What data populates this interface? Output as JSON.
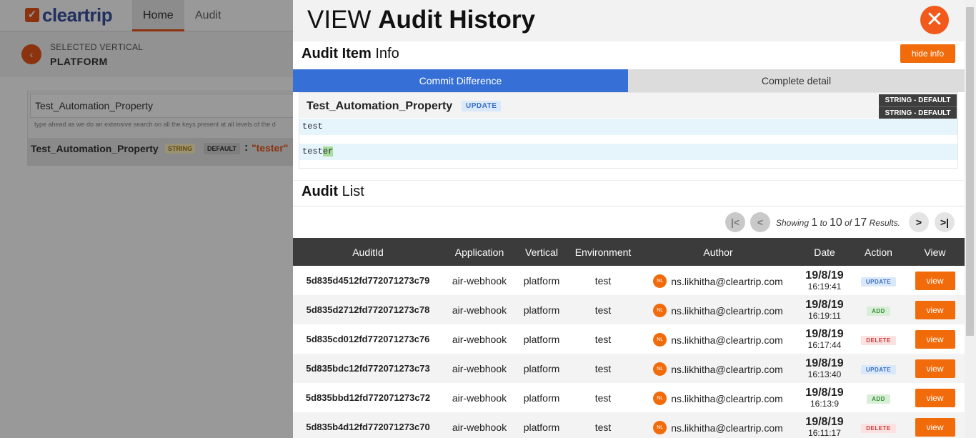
{
  "app": {
    "logo": "cleartrip",
    "nav": [
      "Home",
      "Audit"
    ],
    "selected_vertical_label": "SELECTED VERTICAL",
    "selected_vertical_value": "PLATFORM",
    "search_value": "Test_Automation_Property",
    "search_hint": "type ahead as we do an extensive search on all the keys present at all levels of the d",
    "result": {
      "key": "Test_Automation_Property",
      "type": "STRING",
      "scope": "DEFAULT",
      "colon": ":",
      "value": "\"tester\""
    }
  },
  "modal": {
    "title_light": "VIEW",
    "title_bold": "Audit History",
    "close_icon": "✕",
    "info_bold": "Audit Item",
    "info_light": "Info",
    "hide_label": "hide info",
    "tabs": [
      "Commit Difference",
      "Complete detail"
    ],
    "diff": {
      "key": "Test_Automation_Property",
      "action": "UPDATE",
      "type_old": "STRING - DEFAULT",
      "type_new": "STRING - DEFAULT",
      "old_value": "test",
      "new_common": "test",
      "new_added": "er"
    },
    "list_bold": "Audit",
    "list_light": "List",
    "pager": {
      "showing": "Showing",
      "from": "1",
      "to_word": "to",
      "to": "10",
      "of_word": "of",
      "total": "17",
      "results": "Results."
    },
    "columns": [
      "AuditId",
      "Application",
      "Vertical",
      "Environment",
      "Author",
      "Date",
      "Action",
      "View"
    ],
    "rows": [
      {
        "id": "5d835d4512fd772071273c79",
        "app": "air-webhook",
        "vertical": "platform",
        "env": "test",
        "initials": "NL",
        "author": "ns.likhitha@cleartrip.com",
        "date": "19/8/19",
        "time": "16:19:41",
        "action": "UPDATE",
        "view": "view"
      },
      {
        "id": "5d835d2712fd772071273c78",
        "app": "air-webhook",
        "vertical": "platform",
        "env": "test",
        "initials": "NL",
        "author": "ns.likhitha@cleartrip.com",
        "date": "19/8/19",
        "time": "16:19:11",
        "action": "ADD",
        "view": "view"
      },
      {
        "id": "5d835cd012fd772071273c76",
        "app": "air-webhook",
        "vertical": "platform",
        "env": "test",
        "initials": "NL",
        "author": "ns.likhitha@cleartrip.com",
        "date": "19/8/19",
        "time": "16:17:44",
        "action": "DELETE",
        "view": "view"
      },
      {
        "id": "5d835bdc12fd772071273c73",
        "app": "air-webhook",
        "vertical": "platform",
        "env": "test",
        "initials": "NL",
        "author": "ns.likhitha@cleartrip.com",
        "date": "19/8/19",
        "time": "16:13:40",
        "action": "UPDATE",
        "view": "view"
      },
      {
        "id": "5d835bbd12fd772071273c72",
        "app": "air-webhook",
        "vertical": "platform",
        "env": "test",
        "initials": "NL",
        "author": "ns.likhitha@cleartrip.com",
        "date": "19/8/19",
        "time": "16:13:9",
        "action": "ADD",
        "view": "view"
      },
      {
        "id": "5d835b4d12fd772071273c70",
        "app": "air-webhook",
        "vertical": "platform",
        "env": "test",
        "initials": "NL",
        "author": "ns.likhitha@cleartrip.com",
        "date": "19/8/19",
        "time": "16:11:17",
        "action": "DELETE",
        "view": "view"
      }
    ]
  },
  "colors": {
    "accent": "#f26b0a",
    "tab_active": "#3670d6",
    "header_dark": "#3b3b3b",
    "brand_blue": "#3a4f9e"
  }
}
